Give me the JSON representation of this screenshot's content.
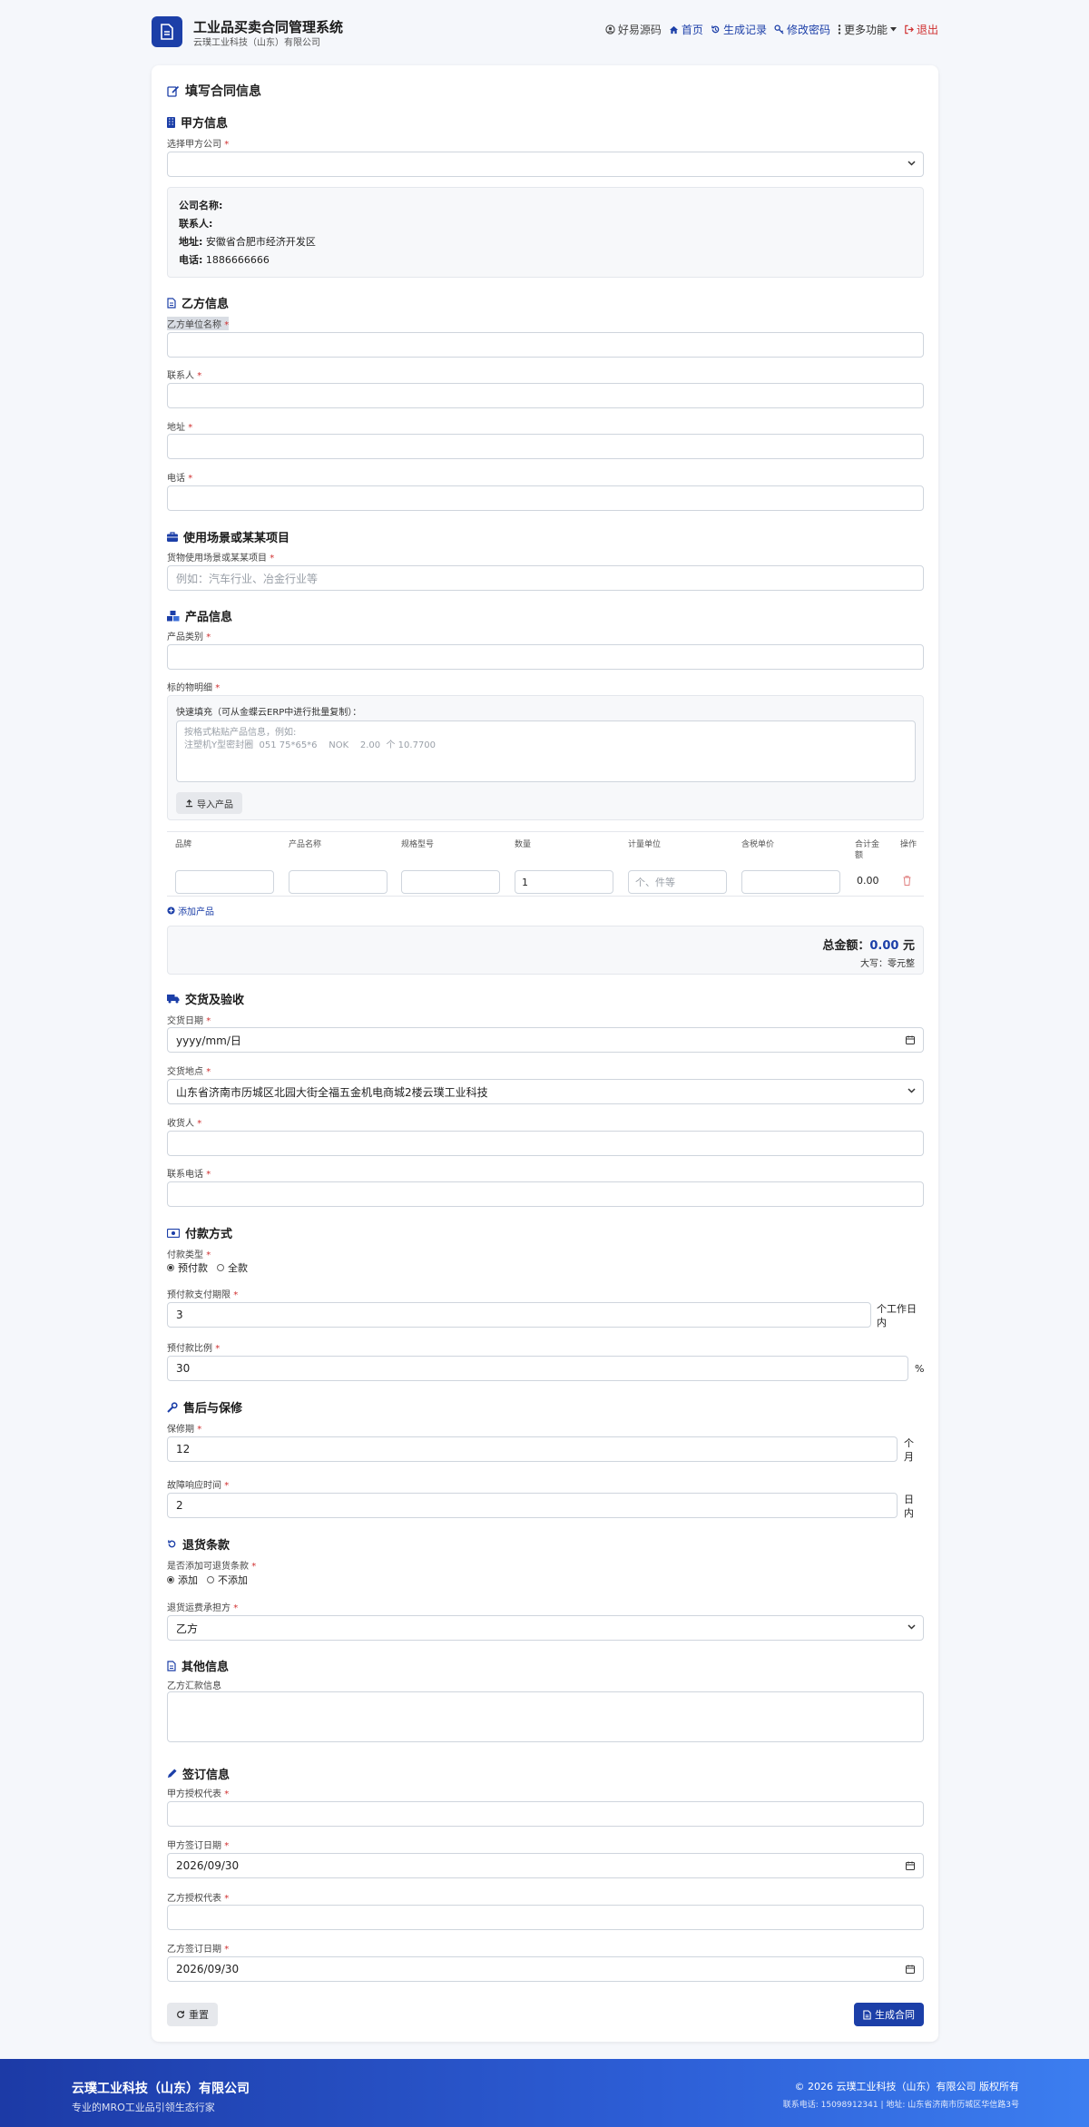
{
  "header": {
    "title": "工业品买卖合同管理系统",
    "subtitle": "云璞工业科技（山东）有限公司",
    "nav": {
      "source": "好易源码",
      "home": "首页",
      "history": "生成记录",
      "password": "修改密码",
      "more": "更多功能",
      "logout": "退出"
    }
  },
  "form": {
    "title": "填写合同信息",
    "party_a": {
      "heading": "甲方信息",
      "select_label": "选择甲方公司",
      "select_value": "",
      "info": {
        "company_label": "公司名称:",
        "company_value": "",
        "contact_label": "联系人:",
        "contact_value": "",
        "address_label": "地址:",
        "address_value": "安徽省合肥市经济开发区",
        "phone_label": "电话:",
        "phone_value": "1886666666"
      }
    },
    "party_b": {
      "heading": "乙方信息",
      "name_label": "乙方单位名称",
      "contact_label": "联系人",
      "address_label": "地址",
      "phone_label": "电话"
    },
    "scene": {
      "heading": "使用场景或某某项目",
      "label": "货物使用场景或某某项目",
      "placeholder": "例如：汽车行业、冶金行业等"
    },
    "product": {
      "heading": "产品信息",
      "category_label": "产品类别",
      "detail_label": "标的物明细",
      "quick_label": "快速填充（可从金蝶云ERP中进行批量复制）：",
      "quick_placeholder": "按格式粘贴产品信息，例如:\n注塑机Y型密封圈  051 75*65*6    NOK    2.00  个 10.7700",
      "import_button": "导入产品",
      "columns": {
        "brand": "品牌",
        "name": "产品名称",
        "spec": "规格型号",
        "qty": "数量",
        "unit": "计量单位",
        "price": "含税单价",
        "subtotal_1": "合计金",
        "subtotal_2": "额",
        "action": "操作"
      },
      "row": {
        "brand": "",
        "name": "",
        "spec": "",
        "qty": "1",
        "unit_placeholder": "个、件等",
        "price": "",
        "subtotal": "0.00"
      },
      "add_button": "添加产品",
      "total_label": "总金额：",
      "total_value": "0.00",
      "total_unit": "元",
      "capital_label": "大写：",
      "capital_value": "零元整"
    },
    "delivery": {
      "heading": "交货及验收",
      "date_label": "交货日期",
      "date_value": "yyyy/mm/日",
      "place_label": "交货地点",
      "place_value": "山东省济南市历城区北园大街全福五金机电商城2楼云璞工业科技",
      "receiver_label": "收货人",
      "receiver_phone_label": "联系电话"
    },
    "payment": {
      "heading": "付款方式",
      "type_label": "付款类型",
      "option_prepay": "预付款",
      "option_full": "全款",
      "term_label": "预付款支付期限",
      "term_value": "3",
      "term_suffix_1": "个工作日",
      "term_suffix_2": "内",
      "ratio_label": "预付款比例",
      "ratio_value": "30",
      "ratio_suffix": "%"
    },
    "aftersale": {
      "heading": "售后与保修",
      "warranty_label": "保修期",
      "warranty_value": "12",
      "warranty_suffix_1": "个",
      "warranty_suffix_2": "月",
      "response_label": "故障响应时间",
      "response_value": "2",
      "response_suffix_1": "日",
      "response_suffix_2": "内"
    },
    "return": {
      "heading": "退货条款",
      "add_label": "是否添加可退货条款",
      "option_add": "添加",
      "option_no": "不添加",
      "bearer_label": "退货运费承担方",
      "bearer_value": "乙方"
    },
    "other": {
      "heading": "其他信息",
      "remit_label": "乙方汇款信息"
    },
    "sign": {
      "heading": "签订信息",
      "a_rep_label": "甲方授权代表",
      "a_date_label": "甲方签订日期",
      "a_date_value": "2026/09/30",
      "b_rep_label": "乙方授权代表",
      "b_date_label": "乙方签订日期",
      "b_date_value": "2026/09/30"
    },
    "reset_button": "重置",
    "generate_button": "生成合同",
    "required_mark": "*"
  },
  "footer": {
    "company": "云璞工业科技（山东）有限公司",
    "slogan": "专业的MRO工业品引领生态行家",
    "copyright": "© 2026 云璞工业科技（山东）有限公司 版权所有",
    "contact": "联系电话: 15098912341 | 地址: 山东省济南市历城区华信路3号"
  },
  "colors": {
    "primary": "#1c3fa8",
    "danger": "#d03030",
    "footer_start": "#1c3aa6",
    "footer_end": "#3c7ef0"
  }
}
